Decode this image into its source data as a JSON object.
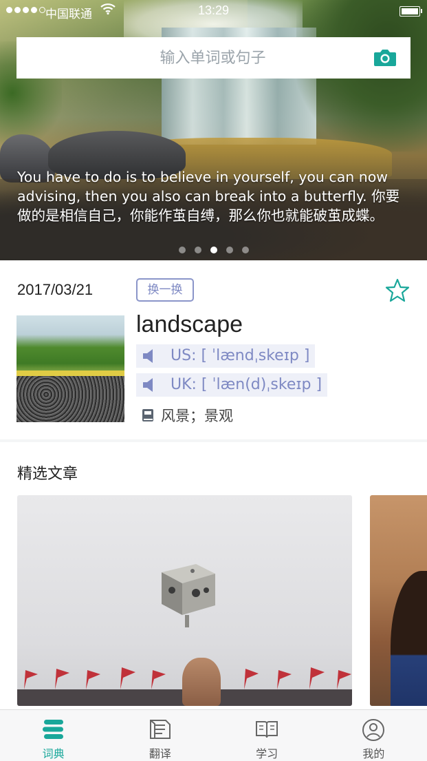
{
  "status_bar": {
    "carrier": "中国联通",
    "time": "13:29"
  },
  "search": {
    "placeholder": "输入单词或句子",
    "icon": "camera-icon"
  },
  "banner": {
    "quote": "You have to do is to believe in yourself, you can now advising, then you also can break into a butterfly. 你要做的是相信自己，你能作茧自缚，那么你也就能破茧成蝶。",
    "page_count": 5,
    "active_page": 3
  },
  "daily_word": {
    "date": "2017/03/21",
    "swap_label": "换一换",
    "word": "landscape",
    "us_phonetic": "US: [ ˈlændˌskeɪp ]",
    "uk_phonetic": "UK: [ ˈlæn(d)ˌskeɪp ]",
    "meaning": "风景；景观"
  },
  "articles": {
    "title": "精选文章"
  },
  "tabs": [
    {
      "label": "词典",
      "icon": "dictionary-icon",
      "active": true
    },
    {
      "label": "翻译",
      "icon": "translate-icon",
      "active": false
    },
    {
      "label": "学习",
      "icon": "book-icon",
      "active": false
    },
    {
      "label": "我的",
      "icon": "profile-icon",
      "active": false
    }
  ],
  "colors": {
    "accent": "#19a79a",
    "phonetic": "#7e89c3",
    "phonetic_bg": "#eef0f8"
  }
}
